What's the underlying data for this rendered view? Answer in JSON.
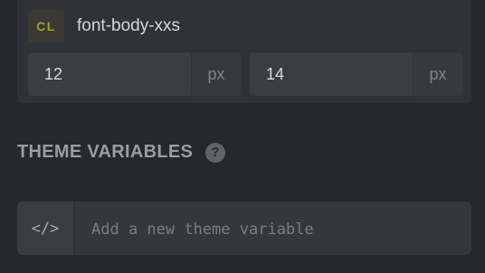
{
  "token": {
    "badge": "CL",
    "name": "font-body-xxs"
  },
  "sizes": [
    {
      "value": "12",
      "unit": "px"
    },
    {
      "value": "14",
      "unit": "px"
    }
  ],
  "theme_variables": {
    "title": "THEME VARIABLES",
    "help_glyph": "?",
    "code_icon_glyph": "</>",
    "placeholder": "Add a new theme variable"
  }
}
